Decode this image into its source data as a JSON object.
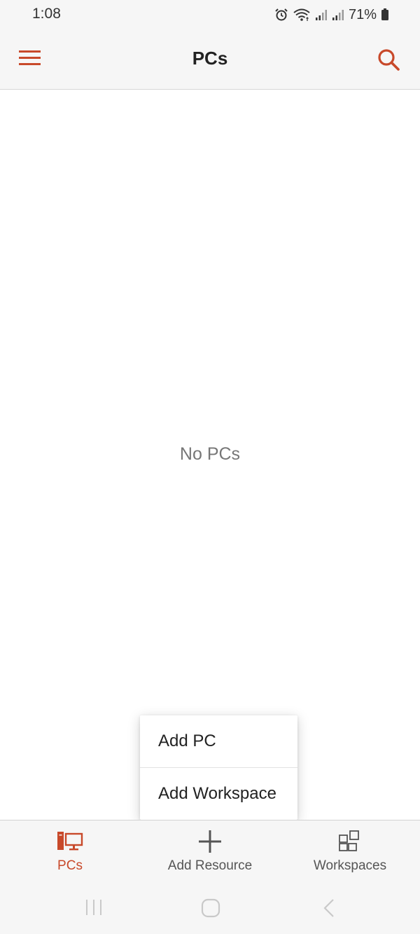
{
  "status_bar": {
    "time": "1:08",
    "battery": "71%",
    "icons": [
      "alarm-icon",
      "wifi-icon",
      "signal-icon",
      "signal-icon",
      "battery-icon"
    ]
  },
  "app_bar": {
    "title": "PCs",
    "menu_icon": "hamburger-menu-icon",
    "search_icon": "search-icon",
    "accent_color": "#c8492a"
  },
  "main": {
    "empty_message": "No PCs"
  },
  "popup_menu": {
    "items": [
      {
        "label": "Add PC"
      },
      {
        "label": "Add Workspace"
      }
    ]
  },
  "bottom_nav": {
    "tabs": [
      {
        "label": "PCs",
        "icon": "pc-icon",
        "active": true
      },
      {
        "label": "Add Resource",
        "icon": "plus-icon",
        "active": false
      },
      {
        "label": "Workspaces",
        "icon": "workspaces-icon",
        "active": false
      }
    ]
  },
  "system_nav": {
    "buttons": [
      "recent-apps-icon",
      "home-icon",
      "back-icon"
    ]
  }
}
